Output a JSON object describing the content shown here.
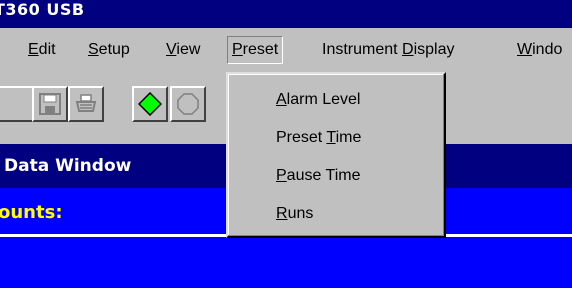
{
  "window": {
    "title": "T360 USB"
  },
  "menubar": {
    "items": [
      {
        "pre": "",
        "ul": "E",
        "post": "dit"
      },
      {
        "pre": "",
        "ul": "S",
        "post": "etup"
      },
      {
        "pre": "",
        "ul": "V",
        "post": "iew"
      },
      {
        "pre": "",
        "ul": "P",
        "post": "reset"
      },
      {
        "pre": "Instrument ",
        "ul": "D",
        "post": "isplay"
      },
      {
        "pre": "",
        "ul": "W",
        "post": "indo"
      }
    ]
  },
  "toolbar": {
    "buttons": [
      "save-icon",
      "print-icon",
      "start-icon",
      "stop-icon"
    ],
    "colors": {
      "start": "#00ff00",
      "face": "#c0c0c0"
    }
  },
  "preset_menu": {
    "items": [
      {
        "pre": "",
        "ul": "A",
        "post": "larm Level"
      },
      {
        "pre": "Preset ",
        "ul": "T",
        "post": "ime"
      },
      {
        "pre": "",
        "ul": "P",
        "post": "ause Time"
      },
      {
        "pre": "",
        "ul": "R",
        "post": "uns"
      }
    ]
  },
  "data_window": {
    "title": "Data Window",
    "counts_label": "ounts:"
  },
  "colors": {
    "titlebar": "#000080",
    "chrome": "#c0c0c0",
    "data_bg": "#0000ff",
    "counts_text": "#ffff00"
  }
}
